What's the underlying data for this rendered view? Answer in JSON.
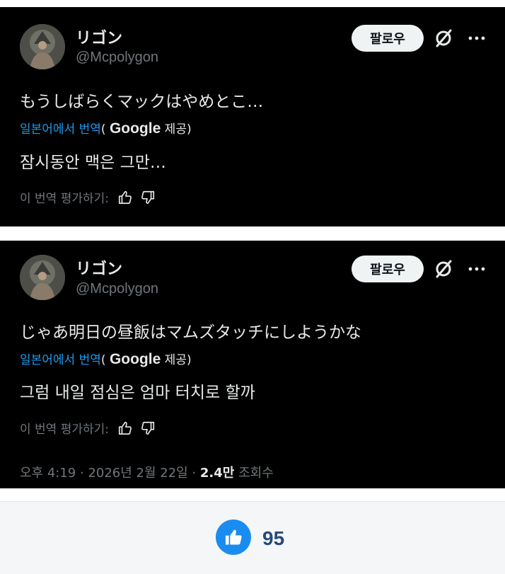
{
  "posts": [
    {
      "display_name": "リゴン",
      "handle": "@Mcpolygon",
      "follow_label": "팔로우",
      "original_text": "もうしばらくマックはやめとこ…",
      "translated_from": "일본어에서 번역",
      "provider_prefix": "(",
      "provider": "Google",
      "provider_suffix": " 제공)",
      "translation": "잠시동안 맥은 그만…",
      "rate_label": "이 번역 평가하기:"
    },
    {
      "display_name": "リゴン",
      "handle": "@Mcpolygon",
      "follow_label": "팔로우",
      "original_text": "じゃあ明日の昼飯はマムズタッチにしようかな",
      "translated_from": "일본어에서 번역",
      "provider_prefix": "(",
      "provider": "Google",
      "provider_suffix": " 제공)",
      "translation": "그럼 내일 점심은 엄마 터치로 할까",
      "rate_label": "이 번역 평가하기:"
    }
  ],
  "meta": {
    "time": "오후 4:19",
    "separator1": " · ",
    "date": "2026년 2월 22일",
    "separator2": " · ",
    "views": "2.4만",
    "views_label": " 조회수"
  },
  "footer": {
    "like_count": "95"
  },
  "colors": {
    "card_bg": "#000000",
    "link_blue": "#1d9bf0",
    "like_blue": "#1a8cf0",
    "muted": "#71767b"
  },
  "icons": [
    "grok-icon",
    "more-icon",
    "thumbs-up-icon",
    "thumbs-down-icon",
    "like-icon"
  ]
}
